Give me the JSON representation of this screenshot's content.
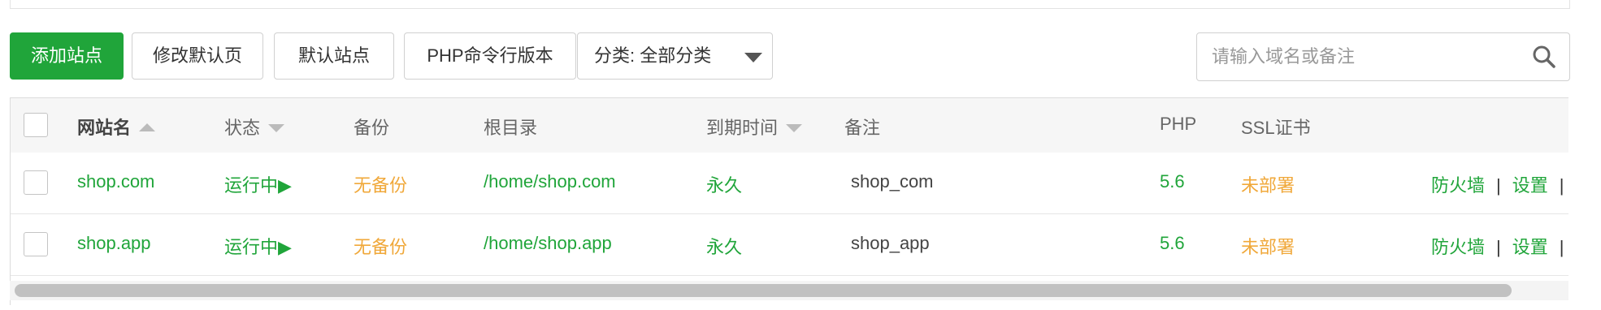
{
  "toolbar": {
    "add_site": "添加站点",
    "modify_default_page": "修改默认页",
    "default_site": "默认站点",
    "php_cli_version": "PHP命令行版本",
    "category_select": "分类: 全部分类"
  },
  "search": {
    "placeholder": "请输入域名或备注"
  },
  "table": {
    "headers": {
      "site_name": "网站名",
      "status": "状态",
      "backup": "备份",
      "root_dir": "根目录",
      "expire": "到期时间",
      "remark": "备注",
      "php": "PHP",
      "ssl": "SSL证书"
    },
    "rows": [
      {
        "site_name": "shop.com",
        "status": "运行中▶",
        "backup": "无备份",
        "root_dir": "/home/shop.com",
        "expire": "永久",
        "remark": "shop_com",
        "php": "5.6",
        "ssl": "未部署",
        "action_firewall": "防火墙",
        "action_separator": "|",
        "action_settings": "设置",
        "action_separator_2": "|"
      },
      {
        "site_name": "shop.app",
        "status": "运行中▶",
        "backup": "无备份",
        "root_dir": "/home/shop.app",
        "expire": "永久",
        "remark": "shop_app",
        "php": "5.6",
        "ssl": "未部署",
        "action_firewall": "防火墙",
        "action_separator": "|",
        "action_settings": "设置",
        "action_separator_2": "|"
      }
    ]
  },
  "colors": {
    "primary_green": "#20a53a",
    "warning_orange": "#f0a83a",
    "header_bg": "#f6f6f6"
  },
  "icons": {
    "search": "search-icon",
    "dropdown": "caret-down-icon",
    "sort_asc": "caret-up-icon",
    "sort_desc": "caret-down-icon"
  }
}
